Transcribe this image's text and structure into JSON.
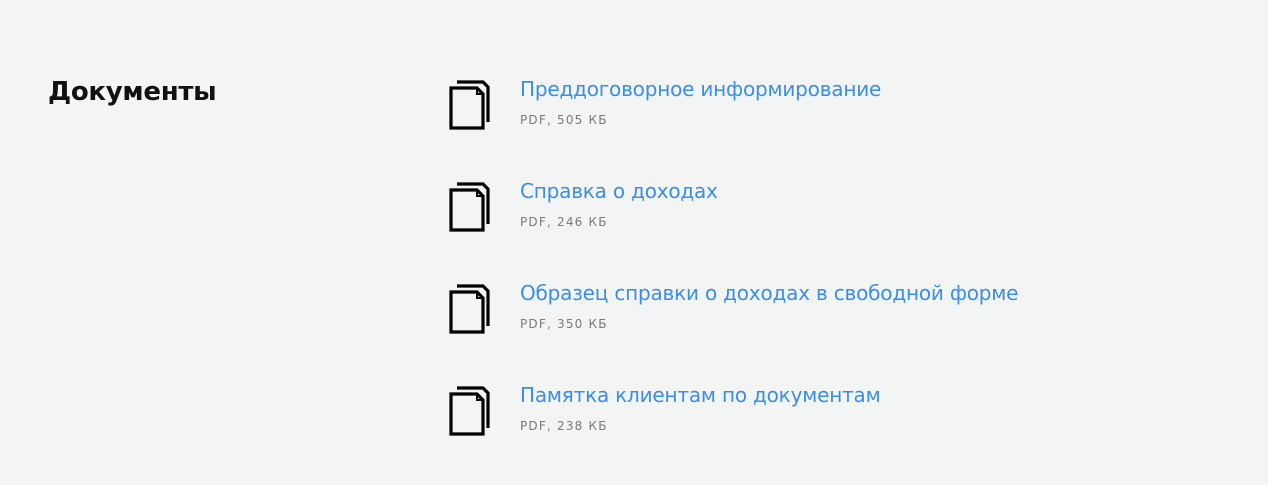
{
  "section": {
    "title": "Документы"
  },
  "documents": [
    {
      "title": "Преддоговорное информирование",
      "meta": "PDF, 505 КБ",
      "icon": "document-icon"
    },
    {
      "title": "Справка о доходах",
      "meta": "PDF, 246 КБ",
      "icon": "document-icon"
    },
    {
      "title": "Образец справки о доходах в свободной форме",
      "meta": "PDF, 350 КБ",
      "icon": "document-icon"
    },
    {
      "title": "Памятка клиентам по документам",
      "meta": "PDF, 238 КБ",
      "icon": "document-icon"
    }
  ],
  "colors": {
    "background": "#f3f4f4",
    "link": "#3a8ee6",
    "meta": "#7a7a7a",
    "title": "#111111"
  }
}
